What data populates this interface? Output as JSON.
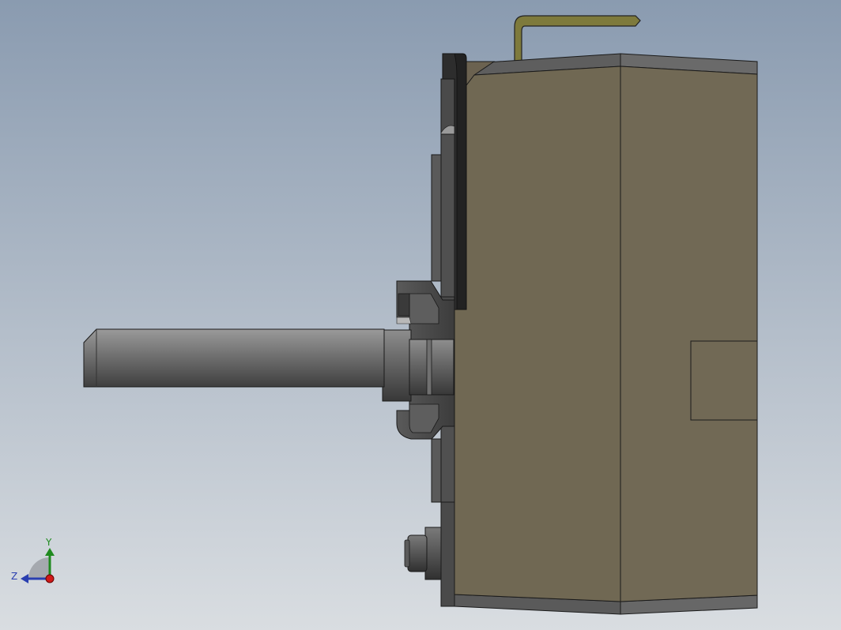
{
  "viewport": {
    "background_top": "#8a9bb0",
    "background_bottom": "#d9dde1"
  },
  "model": {
    "body_color": "#706853",
    "body_edge_color": "#1a1a1a",
    "shaft_color": "#6e6e6e",
    "handle_color": "#7e7a3c",
    "flange_color": "#565656",
    "dark_plate_color": "#222222"
  },
  "triad": {
    "x_label": "",
    "y_label": "Y",
    "z_label": "Z",
    "y_color": "#1f8a1f",
    "z_color": "#2a3fb0",
    "origin_color": "#d01a1a"
  }
}
